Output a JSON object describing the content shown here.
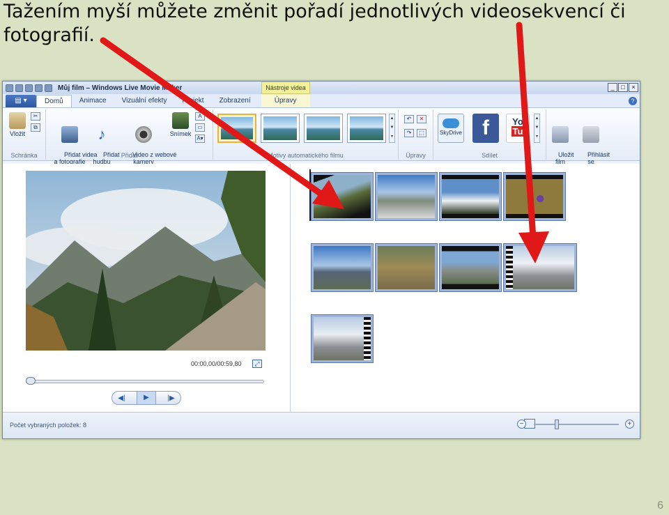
{
  "slide": {
    "title": "Tažením myší můžete změnit pořadí jednotlivých videosekvencí či fotografií.",
    "page_number": "6"
  },
  "window": {
    "title": "Můj film – Windows Live Movie Maker",
    "context_tab": "Nástroje videa",
    "buttons": [
      "_",
      "□",
      "×"
    ]
  },
  "tabs": [
    "Domů",
    "Animace",
    "Vizuální efekty",
    "Projekt",
    "Zobrazení",
    "Úpravy"
  ],
  "ribbon": {
    "schranka": {
      "label": "Schránka",
      "paste": "Vložit"
    },
    "pridat": {
      "label": "Přidat",
      "add_video": "Přidat videa\na fotografie",
      "add_music": "Přidat\nhudbu",
      "webcam": "Video z webové\nkamery",
      "snapshot": "Snímek"
    },
    "themes_label": "Motivy automatického filmu",
    "upravy_label": "Úpravy",
    "sdilet": {
      "label": "Sdílet",
      "skydrive": "SkyDrive"
    },
    "save_movie": "Uložit\nfilm",
    "sign_in": "Přihlásit\nse"
  },
  "preview": {
    "timecode": "00:00,00/00:59,80"
  },
  "status": {
    "selected_items": "Počet vybraných položek: 8"
  },
  "colors": {
    "arrow": "#e01818",
    "background": "#d9e2c2"
  }
}
